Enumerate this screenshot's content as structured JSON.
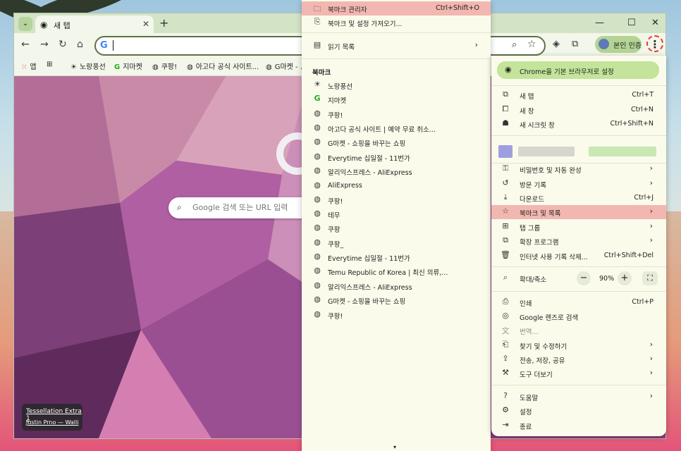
{
  "tab": {
    "title": "새 탭"
  },
  "omnibox": {
    "value": ""
  },
  "profile_label": "본인 인증",
  "bookmarks_bar": [
    {
      "label": "앱",
      "icon": "apps-grid-icon"
    },
    {
      "label": "",
      "icon": "tab-groups-icon"
    },
    {
      "label": "노랑풍선",
      "icon": "sun-icon"
    },
    {
      "label": "지마켓",
      "icon": "gmarket-icon"
    },
    {
      "label": "쿠팡!",
      "icon": "globe-icon"
    },
    {
      "label": "아고다 공식 사이트...",
      "icon": "globe-icon"
    },
    {
      "label": "G마켓 - ...",
      "icon": "globe-icon"
    }
  ],
  "ntp": {
    "search_placeholder": "Google 검색 또는 URL 입력",
    "credit_title": "Tessellation Extra 1",
    "credit_author": "Justin Prno — Walli"
  },
  "submenu": {
    "manager": {
      "label": "북마크 관리자",
      "shortcut": "Ctrl+Shift+O"
    },
    "import": {
      "label": "북마크 및 설정 가져오기..."
    },
    "reading_list": {
      "label": "읽기 목록"
    },
    "section_title": "북마크",
    "items": [
      {
        "label": "노랑풍선",
        "icon": "sun-icon"
      },
      {
        "label": "지마켓",
        "icon": "gmarket-icon"
      },
      {
        "label": "쿠팡!",
        "icon": "globe-icon"
      },
      {
        "label": "아고다 공식 사이트 | 예약 무료 취소...",
        "icon": "globe-icon"
      },
      {
        "label": "G마켓 - 쇼핑을 바꾸는 쇼핑",
        "icon": "globe-icon"
      },
      {
        "label": "Everytime 십일절 - 11번가",
        "icon": "globe-icon"
      },
      {
        "label": "알리익스프레스 - AliExpress",
        "icon": "globe-icon"
      },
      {
        "label": "AliExpress",
        "icon": "globe-icon"
      },
      {
        "label": "쿠팡!",
        "icon": "globe-icon"
      },
      {
        "label": "테무",
        "icon": "globe-icon"
      },
      {
        "label": "쿠팡",
        "icon": "globe-icon"
      },
      {
        "label": "쿠팡_",
        "icon": "globe-icon"
      },
      {
        "label": "Everytime 십일절 - 11번가",
        "icon": "globe-icon"
      },
      {
        "label": "Temu Republic of Korea | 최신 의류,...",
        "icon": "globe-icon"
      },
      {
        "label": "알리익스프레스 - AliExpress",
        "icon": "globe-icon"
      },
      {
        "label": "G마켓 - 쇼핑을 바꾸는 쇼핑",
        "icon": "globe-icon"
      },
      {
        "label": "쿠팡!",
        "icon": "globe-icon"
      }
    ],
    "more_indicator": "▾"
  },
  "menu": {
    "set_default": "Chrome을 기본 브라우저로 설정",
    "new_tab": {
      "label": "새 탭",
      "shortcut": "Ctrl+T"
    },
    "new_window": {
      "label": "새 창",
      "shortcut": "Ctrl+N"
    },
    "incognito": {
      "label": "새 시크릿 창",
      "shortcut": "Ctrl+Shift+N"
    },
    "passwords": {
      "label": "비밀번호 및 자동 완성"
    },
    "history": {
      "label": "방문 기록"
    },
    "downloads": {
      "label": "다운로드",
      "shortcut": "Ctrl+J"
    },
    "bookmarks": {
      "label": "북마크 및 목록"
    },
    "tab_groups": {
      "label": "탭 그룹"
    },
    "extensions": {
      "label": "확장 프로그램"
    },
    "clear_data": {
      "label": "인터넷 사용 기록 삭제...",
      "shortcut": "Ctrl+Shift+Del"
    },
    "zoom": {
      "label": "확대/축소",
      "minus": "−",
      "value": "90%",
      "plus": "+"
    },
    "print": {
      "label": "인쇄",
      "shortcut": "Ctrl+P"
    },
    "lens": {
      "label": "Google 렌즈로 검색"
    },
    "translate": {
      "label": "번역..."
    },
    "find_edit": {
      "label": "찾기 및 수정하기"
    },
    "cast_save": {
      "label": "전송, 저장, 공유"
    },
    "more_tools": {
      "label": "도구 더보기"
    },
    "help": {
      "label": "도움말"
    },
    "settings": {
      "label": "설정"
    },
    "exit": {
      "label": "종료"
    }
  }
}
